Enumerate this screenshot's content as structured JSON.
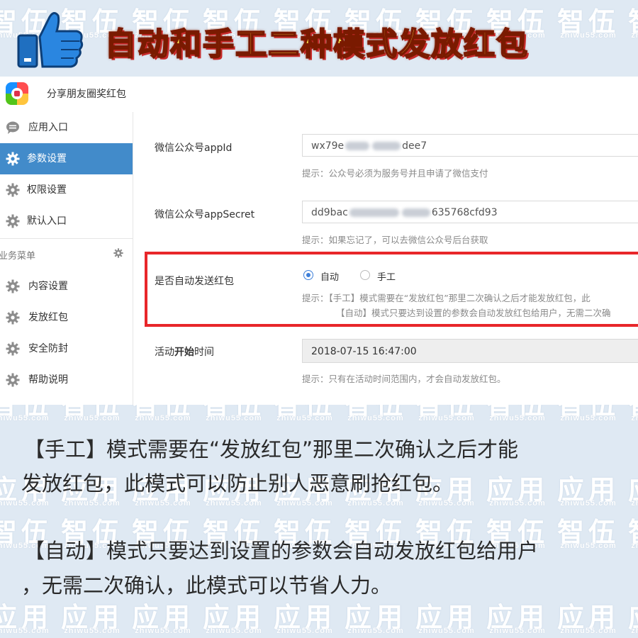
{
  "banner": {
    "title": "自动和手工二种模式发放红包",
    "watermark_big": "智伍",
    "watermark_big_2": "应用",
    "watermark_small": "zhiwu55.com"
  },
  "app": {
    "title": "分享朋友圈奖红包"
  },
  "sidebar": {
    "items": [
      {
        "label": "应用入口",
        "icon": "chat-icon"
      },
      {
        "label": "参数设置",
        "icon": "gear-icon",
        "active": true
      },
      {
        "label": "权限设置",
        "icon": "gear-icon"
      },
      {
        "label": "默认入口",
        "icon": "gear-icon"
      }
    ],
    "section_label": "业务菜单",
    "section_items": [
      {
        "label": "内容设置",
        "icon": "gear-icon"
      },
      {
        "label": "发放红包",
        "icon": "gear-icon"
      },
      {
        "label": "安全防封",
        "icon": "gear-icon"
      },
      {
        "label": "帮助说明",
        "icon": "gear-icon"
      }
    ]
  },
  "form": {
    "appid_label": "微信公众号appId",
    "appid_value_start": "wx79e",
    "appid_value_end": "dee7",
    "appid_hint": "提示：公众号必须为服务号并且申请了微信支付",
    "secret_label": "微信公众号appSecret",
    "secret_value_start": "dd9bac",
    "secret_value_end": "635768cfd93",
    "secret_hint": "提示：如果忘记了，可以去微信公众号后台获取",
    "auto_label": "是否自动发送红包",
    "radio_auto": "自动",
    "radio_manual": "手工",
    "auto_selected": "自动",
    "mode_hint_1": "提示：【手工】模式需要在“发放红包”那里二次确认之后才能发放红包，此",
    "mode_hint_2": "【自动】模式只要达到设置的参数会自动发放红包给用户，无需二次确",
    "start_label_pre": "活动",
    "start_label_bold": "开始",
    "start_label_post": "时间",
    "start_value": "2018-07-15 16:47:00",
    "start_hint": "提示：只有在活动时间范围内，才会自动发放红包。"
  },
  "explain": {
    "line1": "【手工】模式需要在“发放红包”那里二次确认之后才能",
    "line2": "发放红包，此模式可以防止别人恶意刷抢红包。",
    "line3": "【自动】模式只要达到设置的参数会自动发放红包给用户",
    "line4": "，无需二次确认，此模式可以节省人力。"
  },
  "colors": {
    "accent": "#428bca",
    "highlight": "#e8262a",
    "banner_text": "#ffe94a"
  }
}
